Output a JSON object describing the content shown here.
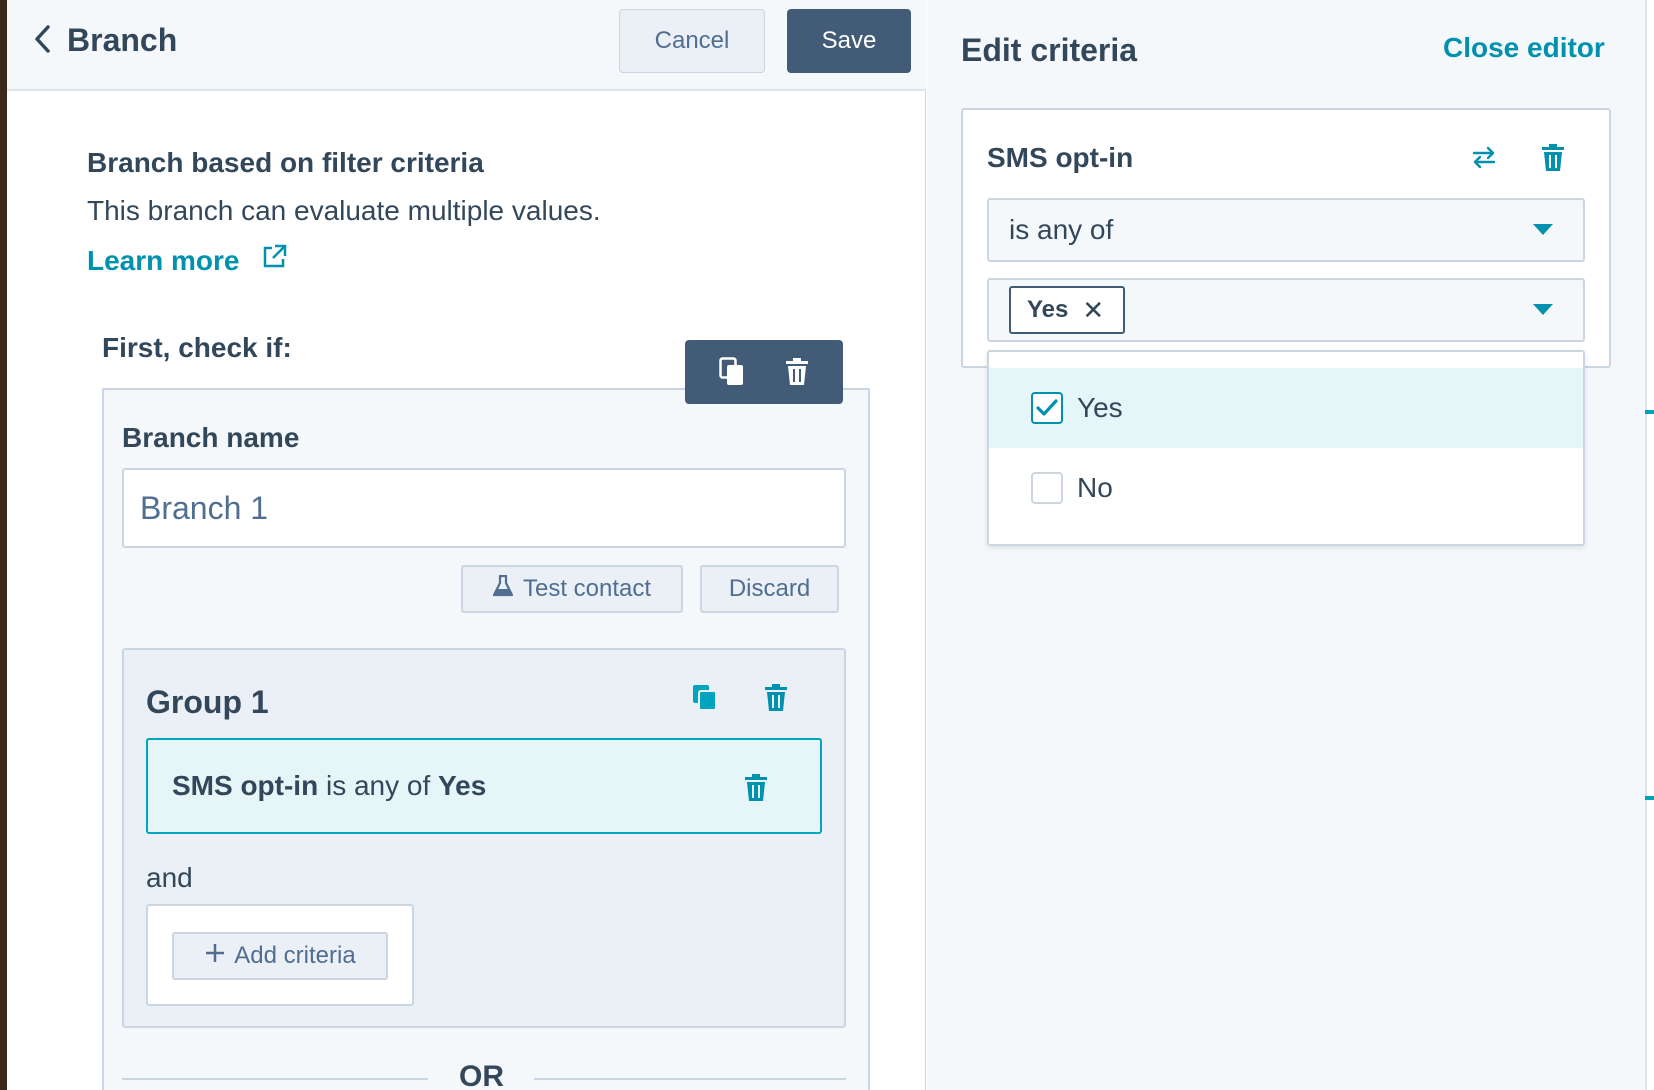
{
  "header": {
    "title": "Branch",
    "cancel_label": "Cancel",
    "save_label": "Save"
  },
  "info": {
    "title": "Branch based on filter criteria",
    "description": "This branch can evaluate multiple values.",
    "learn_more": "Learn more"
  },
  "branch": {
    "first_check_label": "First, check if:",
    "name_label": "Branch name",
    "name_value": "Branch 1",
    "test_contact_label": "Test contact",
    "discard_label": "Discard",
    "or_label": "OR"
  },
  "group": {
    "title": "Group 1",
    "criteria": {
      "property": "SMS opt-in",
      "operator": "is any of",
      "value": "Yes"
    },
    "and_label": "and",
    "add_criteria_label": "Add criteria"
  },
  "editor": {
    "title": "Edit criteria",
    "close_label": "Close editor",
    "property": "SMS opt-in",
    "operator": "is any of",
    "selected_tag": "Yes",
    "options": [
      {
        "label": "Yes",
        "checked": true
      },
      {
        "label": "No",
        "checked": false
      }
    ]
  },
  "colors": {
    "accent": "#0091ae",
    "primary_dark": "#425b76",
    "text": "#33475b",
    "highlight": "#e5f5f8"
  },
  "icons": {
    "back": "chevron-left-icon",
    "external": "external-link-icon",
    "copy": "copy-icon",
    "trash": "trash-icon",
    "swap": "swap-icon",
    "flask": "flask-icon",
    "plus": "plus-icon",
    "close": "close-icon",
    "caret": "caret-down-icon",
    "check": "check-icon"
  }
}
